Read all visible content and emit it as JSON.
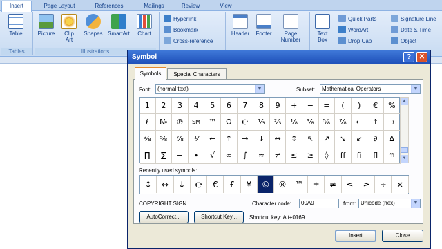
{
  "ribbon": {
    "tabs": [
      "Insert",
      "Page Layout",
      "References",
      "Mailings",
      "Review",
      "View"
    ],
    "groups": {
      "tables": "Tables",
      "illustrations": "Illustrations"
    },
    "buttons": {
      "table": "Table",
      "picture": "Picture",
      "clip_art": "Clip Art",
      "shapes": "Shapes",
      "smartart": "SmartArt",
      "chart": "Chart",
      "hyperlink": "Hyperlink",
      "bookmark": "Bookmark",
      "cross_reference": "Cross-reference",
      "header": "Header",
      "footer": "Footer",
      "page_number": "Page Number",
      "text_box": "Text Box",
      "quick_parts": "Quick Parts",
      "wordart": "WordArt",
      "drop_cap": "Drop Cap",
      "signature_line": "Signature Line",
      "date_time": "Date & Time",
      "object": "Object"
    }
  },
  "dialog": {
    "title": "Symbol",
    "help_glyph": "?",
    "close_glyph": "✕",
    "tabs": {
      "symbols": "Symbols",
      "special_characters": "Special Characters"
    },
    "font_label": "Font:",
    "font_value": "(normal text)",
    "subset_label": "Subset:",
    "subset_value": "Mathematical Operators",
    "symbol_grid": [
      [
        "1",
        "2",
        "3",
        "4",
        "5",
        "6",
        "7",
        "8",
        "9",
        "+",
        "−",
        "=",
        "(",
        ")",
        "€",
        "%"
      ],
      [
        "ℓ",
        "№",
        "℗",
        "SM",
        "™",
        "Ω",
        "℮",
        "⅓",
        "⅔",
        "⅛",
        "⅜",
        "⅝",
        "⅞",
        "←",
        "↑",
        "→"
      ],
      [
        "⅜",
        "⅝",
        "⅞",
        "⅟",
        "←",
        "↑",
        "→",
        "↓",
        "↔",
        "↕",
        "↖",
        "↗",
        "↘",
        "↙",
        "∂",
        "∆"
      ],
      [
        "∏",
        "∑",
        "−",
        "∙",
        "√",
        "∞",
        "∫",
        "≈",
        "≠",
        "≤",
        "≥",
        "◊",
        "ff",
        "fi",
        "fl",
        "ffi"
      ]
    ],
    "recent_label": "Recently used symbols:",
    "recent_symbols": [
      "↕",
      "↔",
      "↓",
      "℮",
      "€",
      "£",
      "¥",
      "©",
      "®",
      "™",
      "±",
      "≠",
      "≤",
      "≥",
      "÷",
      "×"
    ],
    "selected_recent_index": 7,
    "char_name": "COPYRIGHT SIGN",
    "char_code_label": "Character code:",
    "char_code_value": "00A9",
    "from_label": "from:",
    "from_value": "Unicode (hex)",
    "autocorrect_label": "AutoCorrect...",
    "shortcut_key_label": "Shortcut Key...",
    "shortcut_key_text": "Shortcut key: Alt+0169",
    "insert_label": "Insert",
    "close_label": "Close"
  }
}
